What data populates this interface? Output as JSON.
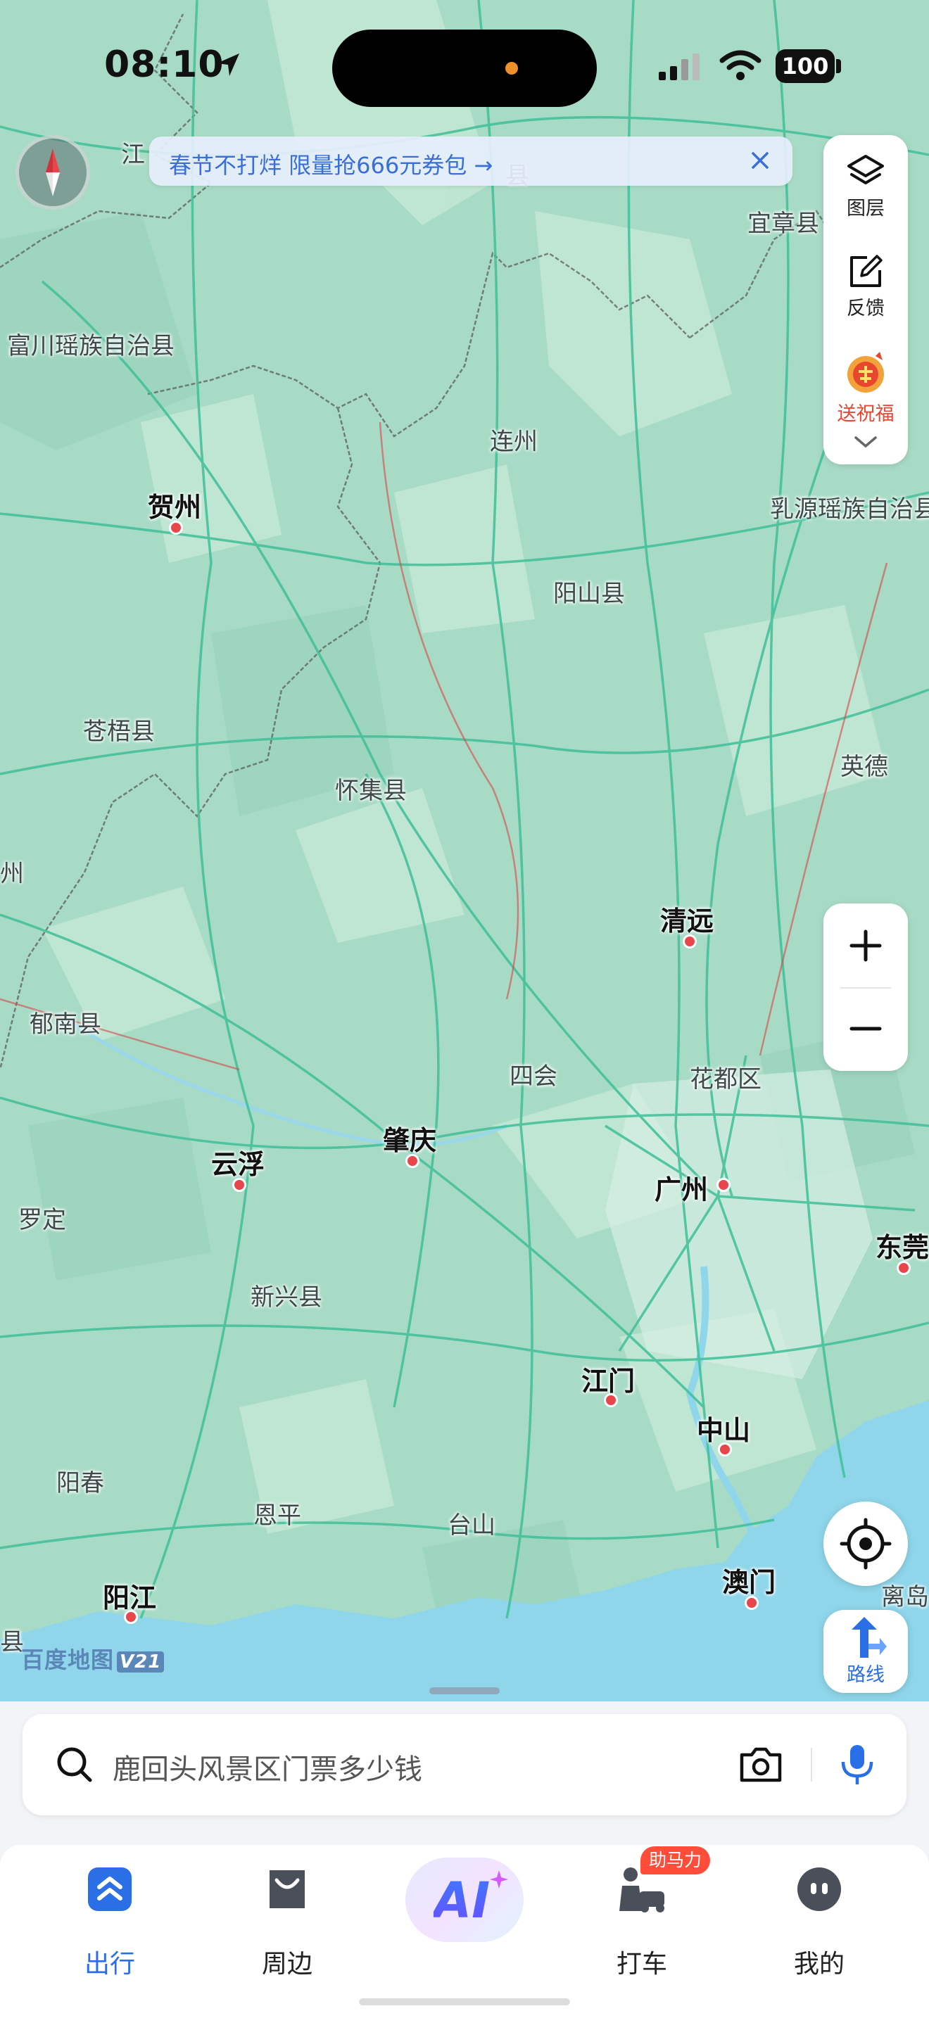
{
  "status_bar": {
    "time": "08:10",
    "battery": "100"
  },
  "promo_banner": {
    "text": "春节不打烊 限量抢666元券包 →"
  },
  "tools": {
    "layers": "图层",
    "feedback": "反馈",
    "blessing": "送祝福"
  },
  "map": {
    "watermark": "百度地图",
    "watermark_version": "V21",
    "labels": {
      "jiang": "江",
      "xian_top": "县",
      "yizhang": "宜章县",
      "fuchuan": "富川瑶族自治县",
      "lianzhou": "连州",
      "hezhou": "贺州",
      "ruyuan": "乳源瑶族自治县",
      "yangshan": "阳山县",
      "cangwu": "苍梧县",
      "huaiji": "怀集县",
      "yingde": "英德",
      "zhou_left": "州",
      "qingyuan": "清远",
      "dunan": "郁南县",
      "sihui": "四会",
      "huadu": "花都区",
      "zhaoqing": "肇庆",
      "yunfu": "云浮",
      "guangzhou": "广州",
      "luoding": "罗定",
      "dongguan": "东莞",
      "xinxing": "新兴县",
      "jiangmen": "江门",
      "zhongshan": "中山",
      "yangchun": "阳春",
      "enping": "恩平",
      "taishan": "台山",
      "aomen": "澳门",
      "lidao": "离岛",
      "yangjiang": "阳江",
      "xian_left": "县"
    }
  },
  "controls": {
    "route": "路线"
  },
  "search": {
    "placeholder": "鹿回头风景区门票多少钱"
  },
  "nav": {
    "items": [
      "出行",
      "周边",
      "打车",
      "我的"
    ],
    "ai": "AI",
    "badge": "助马力",
    "active_color": "#2a6fe6"
  }
}
